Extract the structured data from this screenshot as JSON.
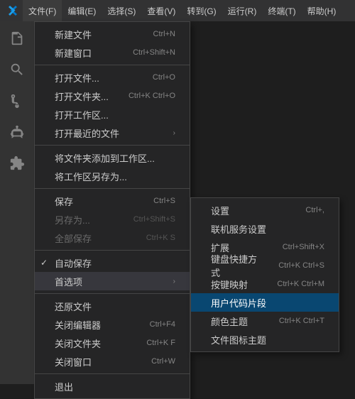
{
  "menubar": {
    "logo": "⌥",
    "items": [
      {
        "label": "文件(F)",
        "active": true
      },
      {
        "label": "编辑(E)"
      },
      {
        "label": "选择(S)"
      },
      {
        "label": "查看(V)"
      },
      {
        "label": "转到(G)"
      },
      {
        "label": "运行(R)"
      },
      {
        "label": "终端(T)"
      },
      {
        "label": "帮助(H)"
      }
    ]
  },
  "sidebar": {
    "icons": [
      {
        "name": "files-icon",
        "symbol": "⎘"
      },
      {
        "name": "search-icon",
        "symbol": "🔍"
      },
      {
        "name": "source-control-icon",
        "symbol": "⑂"
      },
      {
        "name": "debug-icon",
        "symbol": "⬡"
      },
      {
        "name": "extensions-icon",
        "symbol": "⊞"
      }
    ]
  },
  "file_menu": {
    "items": [
      {
        "id": "new-file",
        "label": "新建文件",
        "shortcut": "Ctrl+N",
        "separator_after": false
      },
      {
        "id": "new-window",
        "label": "新建窗口",
        "shortcut": "Ctrl+Shift+N",
        "separator_after": true
      },
      {
        "id": "open-file",
        "label": "打开文件...",
        "shortcut": "Ctrl+O",
        "separator_after": false
      },
      {
        "id": "open-folder",
        "label": "打开文件夹...",
        "shortcut": "Ctrl+K Ctrl+O",
        "separator_after": false
      },
      {
        "id": "open-workspace",
        "label": "打开工作区...",
        "shortcut": "",
        "separator_after": false
      },
      {
        "id": "open-recent",
        "label": "打开最近的文件",
        "shortcut": "",
        "arrow": true,
        "separator_after": true
      },
      {
        "id": "add-folder",
        "label": "将文件夹添加到工作区...",
        "shortcut": "",
        "separator_after": false
      },
      {
        "id": "save-workspace-as",
        "label": "将工作区另存为...",
        "shortcut": "",
        "separator_after": true
      },
      {
        "id": "save",
        "label": "保存",
        "shortcut": "Ctrl+S",
        "separator_after": false
      },
      {
        "id": "save-as",
        "label": "另存为...",
        "shortcut": "Ctrl+Shift+S",
        "disabled": true,
        "separator_after": false
      },
      {
        "id": "save-all",
        "label": "全部保存",
        "shortcut": "Ctrl+K S",
        "disabled": true,
        "separator_after": true
      },
      {
        "id": "auto-save",
        "label": "自动保存",
        "checked": true,
        "shortcut": "",
        "separator_after": false
      },
      {
        "id": "preferences",
        "label": "首选项",
        "shortcut": "",
        "arrow": true,
        "highlighted": true,
        "separator_after": true
      },
      {
        "id": "revert",
        "label": "还原文件",
        "shortcut": "",
        "separator_after": false
      },
      {
        "id": "close-editor",
        "label": "关闭编辑器",
        "shortcut": "Ctrl+F4",
        "separator_after": false
      },
      {
        "id": "close-folder",
        "label": "关闭文件夹",
        "shortcut": "Ctrl+K F",
        "separator_after": false
      },
      {
        "id": "close-window",
        "label": "关闭窗口",
        "shortcut": "Ctrl+W",
        "separator_after": true
      },
      {
        "id": "exit",
        "label": "退出",
        "shortcut": "",
        "separator_after": false
      }
    ]
  },
  "preferences_submenu": {
    "items": [
      {
        "id": "settings",
        "label": "设置",
        "shortcut": "Ctrl+,"
      },
      {
        "id": "online-services",
        "label": "联机服务设置",
        "shortcut": ""
      },
      {
        "id": "extensions",
        "label": "扩展",
        "shortcut": "Ctrl+Shift+X"
      },
      {
        "id": "keyboard-shortcuts",
        "label": "键盘快捷方式",
        "shortcut": "Ctrl+K Ctrl+S"
      },
      {
        "id": "keymaps",
        "label": "按键映射",
        "shortcut": "Ctrl+K Ctrl+M"
      },
      {
        "id": "user-snippets",
        "label": "用户代码片段",
        "shortcut": "",
        "highlighted": true
      },
      {
        "id": "color-theme",
        "label": "颜色主题",
        "shortcut": "Ctrl+K Ctrl+T"
      },
      {
        "id": "file-icon-theme",
        "label": "文件图标主题",
        "shortcut": ""
      }
    ]
  }
}
